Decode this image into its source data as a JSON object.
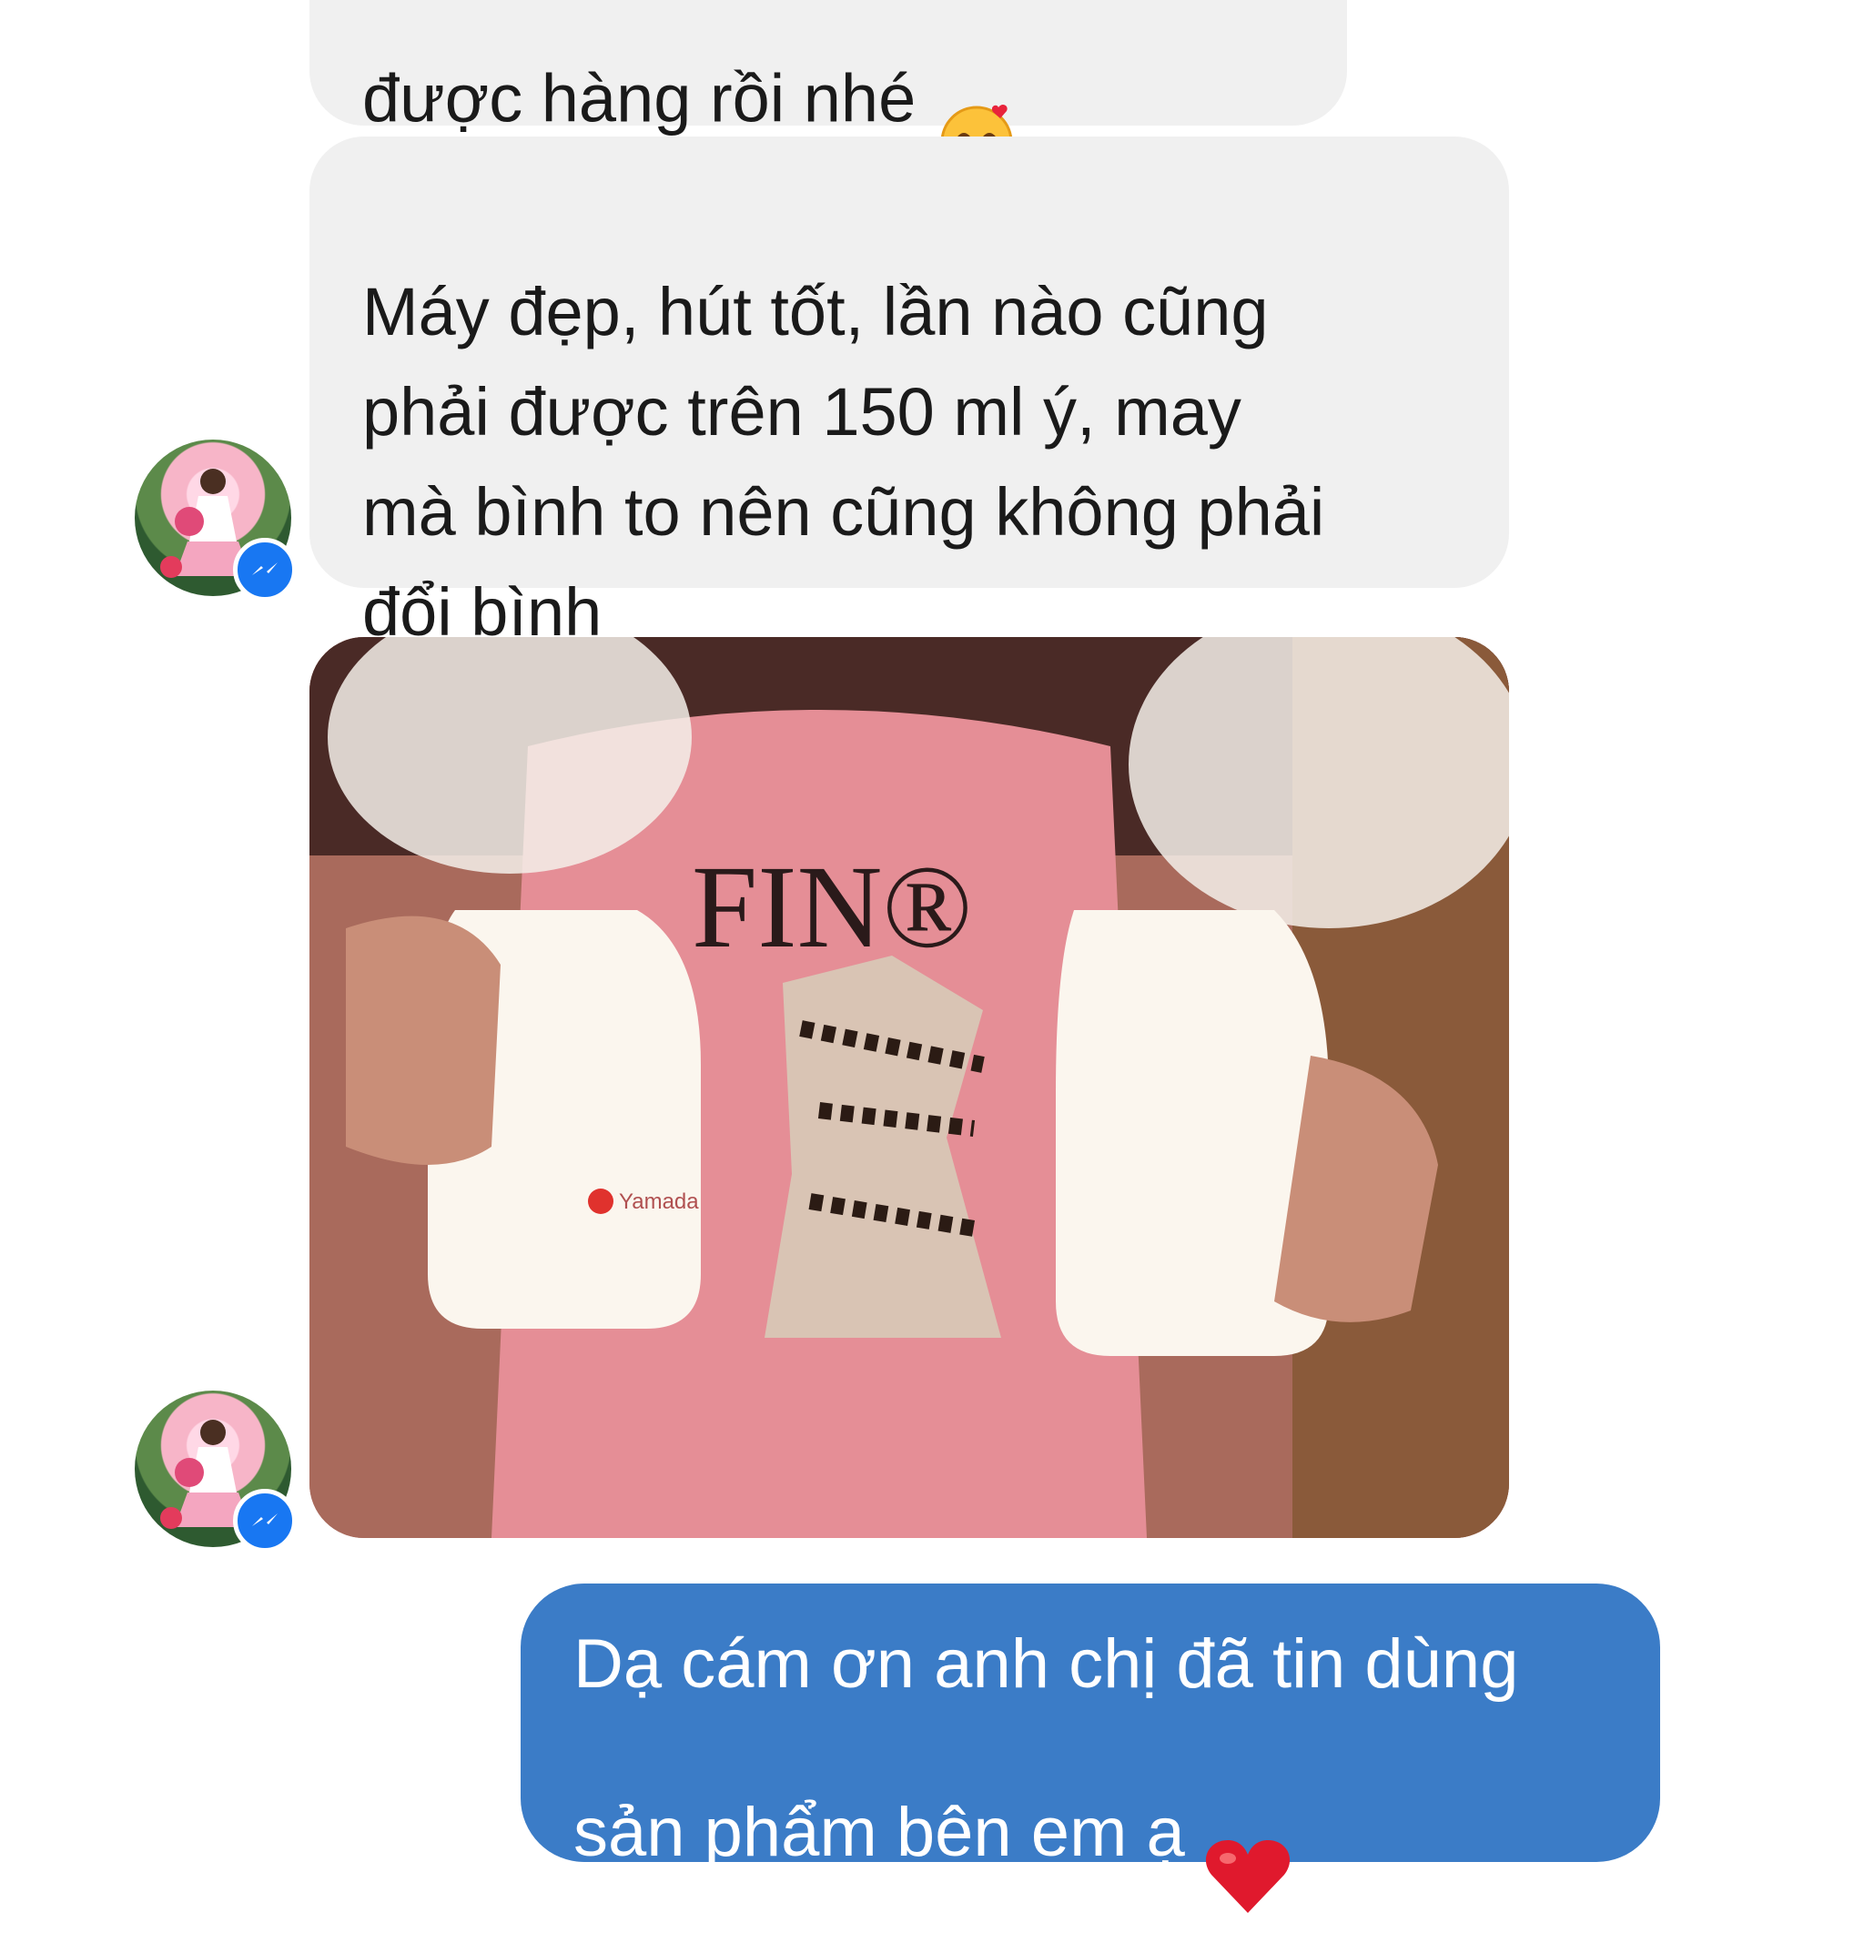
{
  "messages": [
    {
      "sender": "customer",
      "text": "được hàng rồi nhé",
      "emoji": "smiling-face-with-hearts"
    },
    {
      "sender": "customer",
      "text": "Máy đẹp, hút tốt, lần nào cũng\nphải được trên 150 ml ý, may\nmà bình to nên cũng không phải\nđổi bình"
    },
    {
      "sender": "customer",
      "type": "photo",
      "photo_brand": "Yamada",
      "shirt_text": "FIN®"
    },
    {
      "sender": "shop",
      "text": "Dạ cám ơn anh chị đã tin dùng\nsản phẩm bên em ạ",
      "emoji": "red-heart"
    }
  ],
  "colors": {
    "incoming_bubble": "#f0f0f0",
    "outgoing_bubble": "#3b7cc7",
    "messenger_badge": "#1877f2"
  }
}
